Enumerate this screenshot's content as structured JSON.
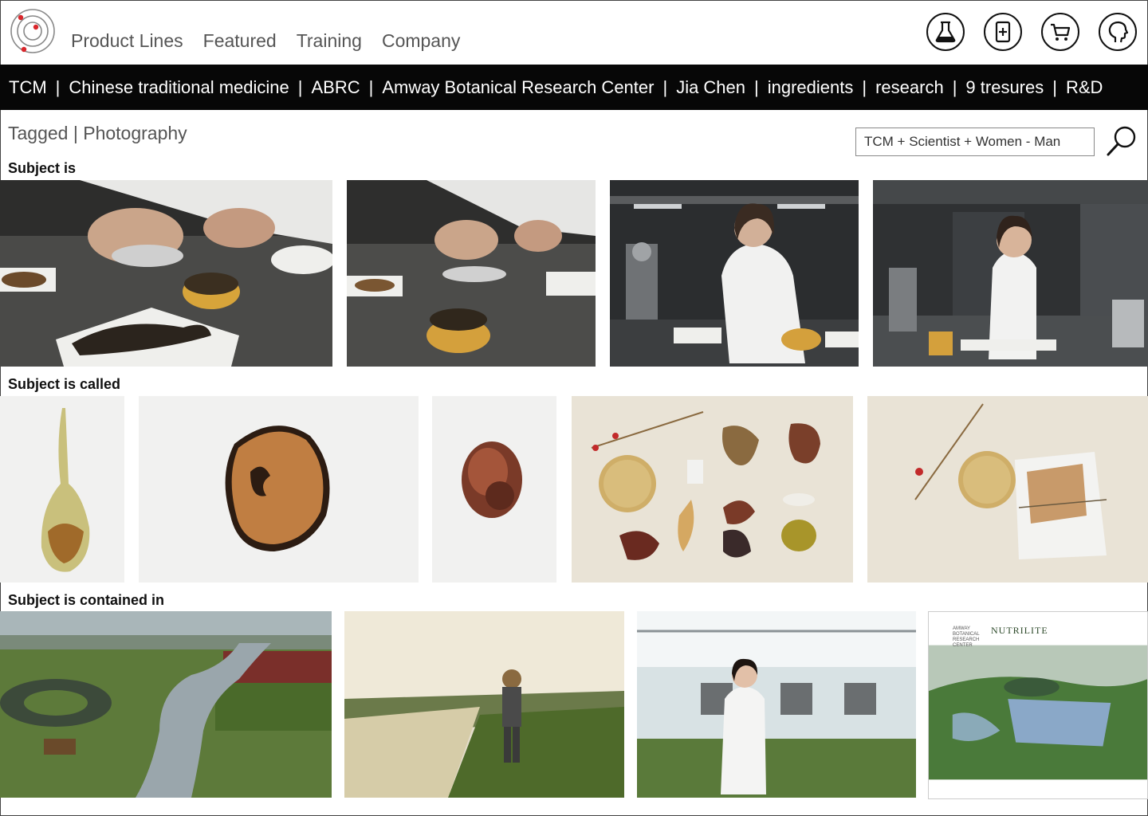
{
  "nav": {
    "items": [
      "Product Lines",
      "Featured",
      "Training",
      "Company"
    ]
  },
  "header_icons": [
    "flask-icon",
    "add-document-icon",
    "cart-icon",
    "profile-head-icon"
  ],
  "tagbar": {
    "tags": [
      "TCM",
      "Chinese traditional medicine",
      "ABRC",
      "Amway Botanical Research Center",
      "Jia Chen",
      "ingredients",
      "research",
      "9 tresures",
      "R&D"
    ],
    "separator": "|"
  },
  "tagged": {
    "prefix": "Tagged",
    "separator": "|",
    "value": "Photography"
  },
  "search": {
    "value": "TCM + Scientist + Women - Man"
  },
  "sections": {
    "subject_is": "Subject is",
    "subject_is_called": "Subject is called",
    "subject_is_contained_in": "Subject is contained in"
  },
  "brochure": {
    "left_text": "AMWAY BOTANICAL RESEARCH CENTER",
    "brand": "NUTRILITE"
  },
  "colors": {
    "tagbar_bg": "#070707",
    "logo_red": "#d9262b",
    "lab_dark": "#2a2c2e",
    "paper_bg": "#e9e3d6"
  }
}
